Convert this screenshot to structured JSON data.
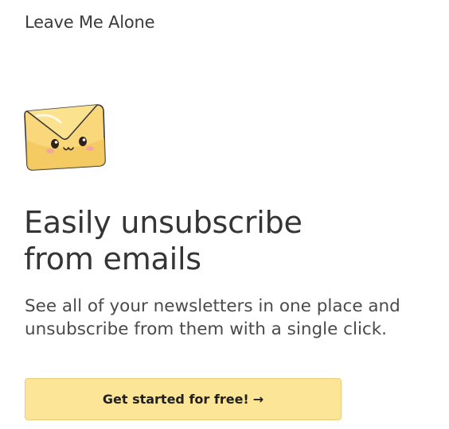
{
  "brand": {
    "name": "Leave Me Alone"
  },
  "mascot": {
    "icon": "envelope-mascot-icon"
  },
  "hero": {
    "headline_line1": "Easily unsubscribe",
    "headline_line2": "from emails",
    "subline_line1": "See all of your newsletters in one place and",
    "subline_line2": "unsubscribe from them with a single click."
  },
  "cta": {
    "label": "Get started for free!",
    "arrow": "→",
    "color": "#fde597"
  }
}
